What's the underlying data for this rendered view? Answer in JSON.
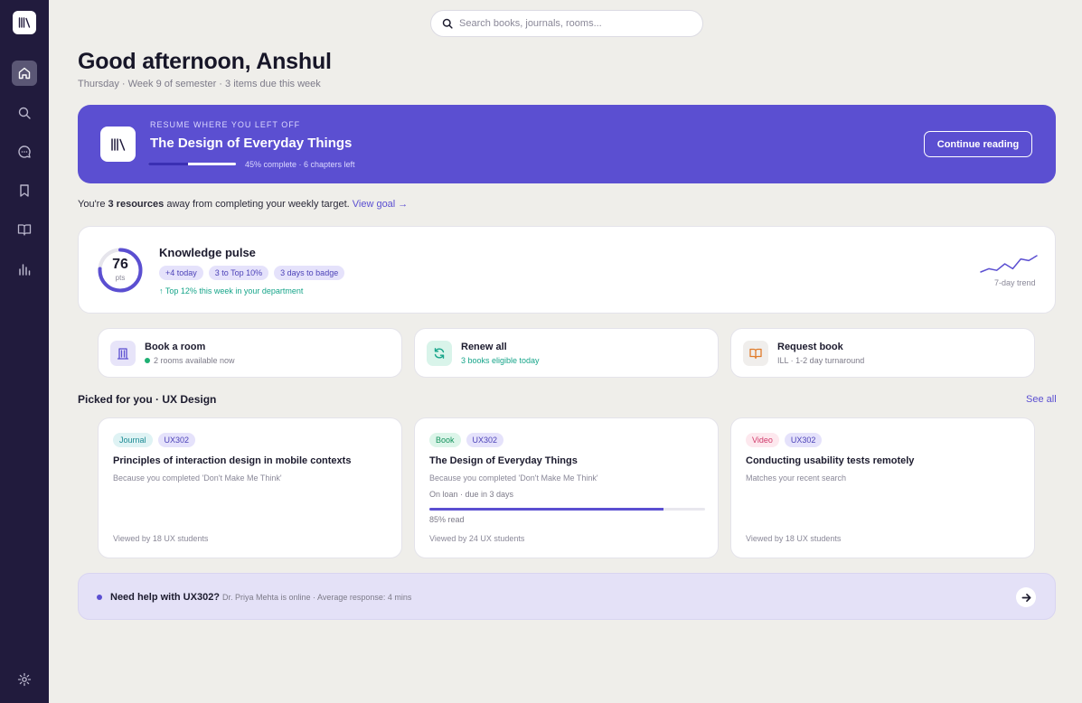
{
  "search": {
    "placeholder": "Search books, journals, rooms..."
  },
  "greeting": {
    "title": "Good afternoon, Anshul",
    "subtitle": "Thursday · Week 9 of semester · 3 items due this week"
  },
  "resume": {
    "eyebrow": "RESUME WHERE YOU LEFT OFF",
    "title": "The Design of Everyday Things",
    "progress": 0.45,
    "meta": "45% complete · 6 chapters left",
    "button": "Continue reading"
  },
  "target": {
    "prefix": "You're ",
    "count": "3 resources",
    "suffix": " away from completing your weekly target. ",
    "link": "View goal →"
  },
  "pulse": {
    "score": "76",
    "unit": "pts",
    "score_fraction": 0.76,
    "title": "Knowledge pulse",
    "chips": [
      "+4 today",
      "3 to Top 10%",
      "3 days to badge"
    ],
    "note": "↑  Top 12% this week in your department",
    "trend_label": "7-day trend",
    "trend_values": [
      3,
      5,
      4,
      8,
      5,
      11,
      10,
      13
    ],
    "accent": "#5b4fd1"
  },
  "actions": [
    {
      "title": "Book a room",
      "subtitle": "2 rooms available now",
      "icon": "door-icon",
      "color": "#5b4fd1"
    },
    {
      "title": "Renew all",
      "subtitle": "3 books eligible today",
      "icon": "refresh-icon",
      "color": "#17a58a"
    },
    {
      "title": "Request book",
      "subtitle": "ILL · 1-2 day turnaround",
      "icon": "book-open-icon",
      "color": "#e07b2a"
    }
  ],
  "picked": {
    "title": "Picked for you · UX Design",
    "see_all": "See all",
    "cards": [
      {
        "type": "Journal",
        "course": "UX302",
        "title": "Principles of interaction design in mobile contexts",
        "reason": "Because you completed 'Don't Make Me Think'",
        "views": "Viewed by 18 UX students"
      },
      {
        "type": "Book",
        "course": "UX302",
        "title": "The Design of Everyday Things",
        "reason": "Because you completed 'Don't Make Me Think'",
        "loan": "On loan · due in 3 days",
        "progress": 0.85,
        "read": "85% read",
        "views": "Viewed by 24 UX students"
      },
      {
        "type": "Video",
        "course": "UX302",
        "title": "Conducting usability tests remotely",
        "reason": "Matches your recent search",
        "views": "Viewed by 18 UX students"
      }
    ]
  },
  "help": {
    "title": "Need help with UX302?",
    "subtitle": "Dr. Priya Mehta is online · Average response: 4 mins"
  }
}
